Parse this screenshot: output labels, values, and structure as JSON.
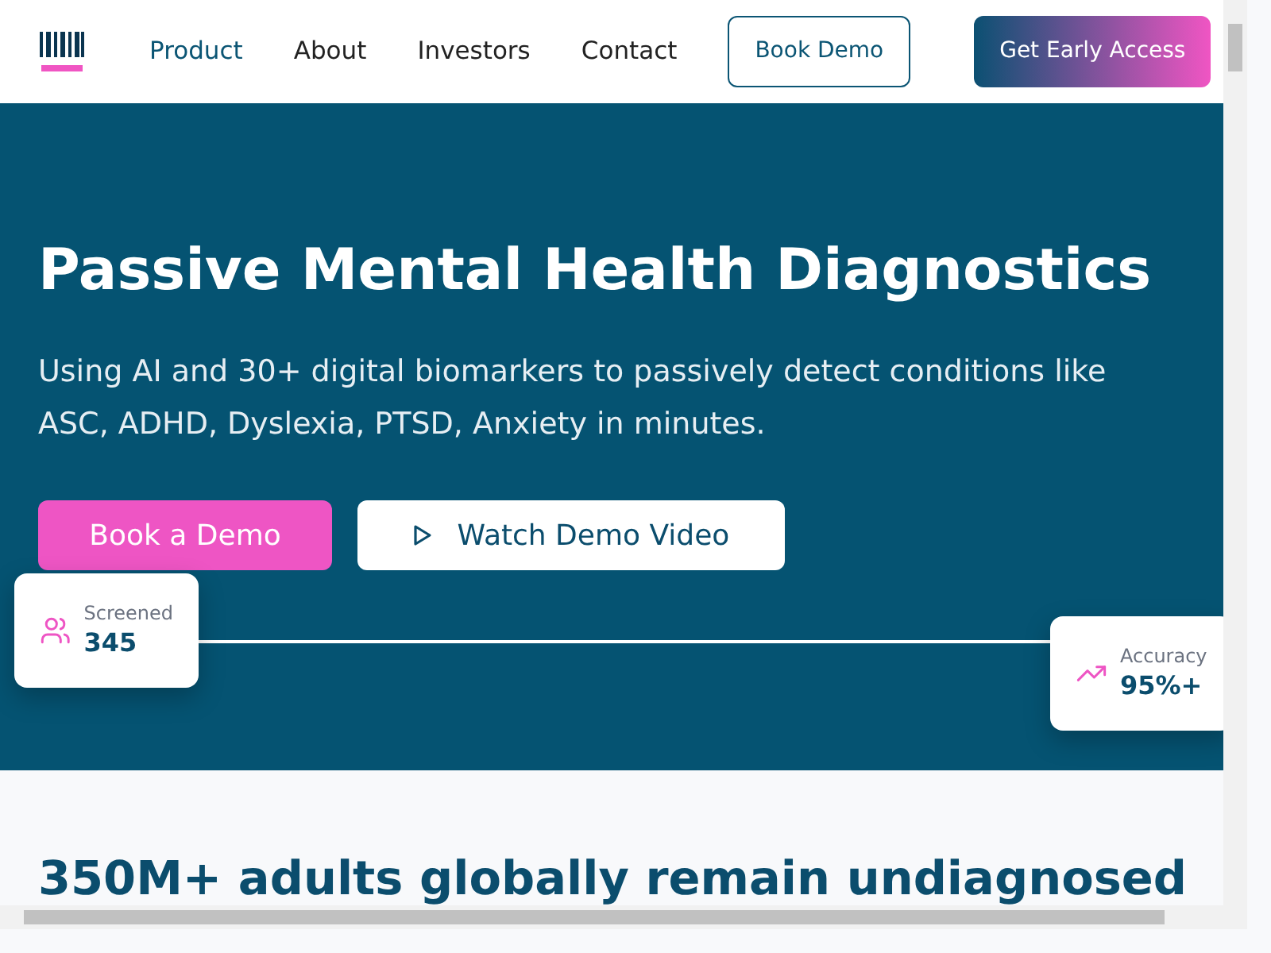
{
  "nav": {
    "links": [
      {
        "label": "Product",
        "selected": true
      },
      {
        "label": "About",
        "selected": false
      },
      {
        "label": "Investors",
        "selected": false
      },
      {
        "label": "Contact",
        "selected": false
      }
    ],
    "outline_button": "Book Demo",
    "cta_button": "Get Early Access"
  },
  "hero": {
    "title": "Passive Mental Health Diagnostics",
    "subtitle": "Using AI and 30+ digital biomarkers to passively detect conditions like ASC, ADHD, Dyslexia, PTSD, Anxiety in minutes.",
    "primary_button": "Book a Demo",
    "video_button": "Watch Demo Video",
    "stats": [
      {
        "kind": "people",
        "label": "Screened",
        "value": "345"
      },
      {
        "kind": "trend",
        "label": "Accuracy",
        "value": "95%+"
      }
    ]
  },
  "section": {
    "heading": "350M+ adults globally remain undiagnosed"
  }
}
